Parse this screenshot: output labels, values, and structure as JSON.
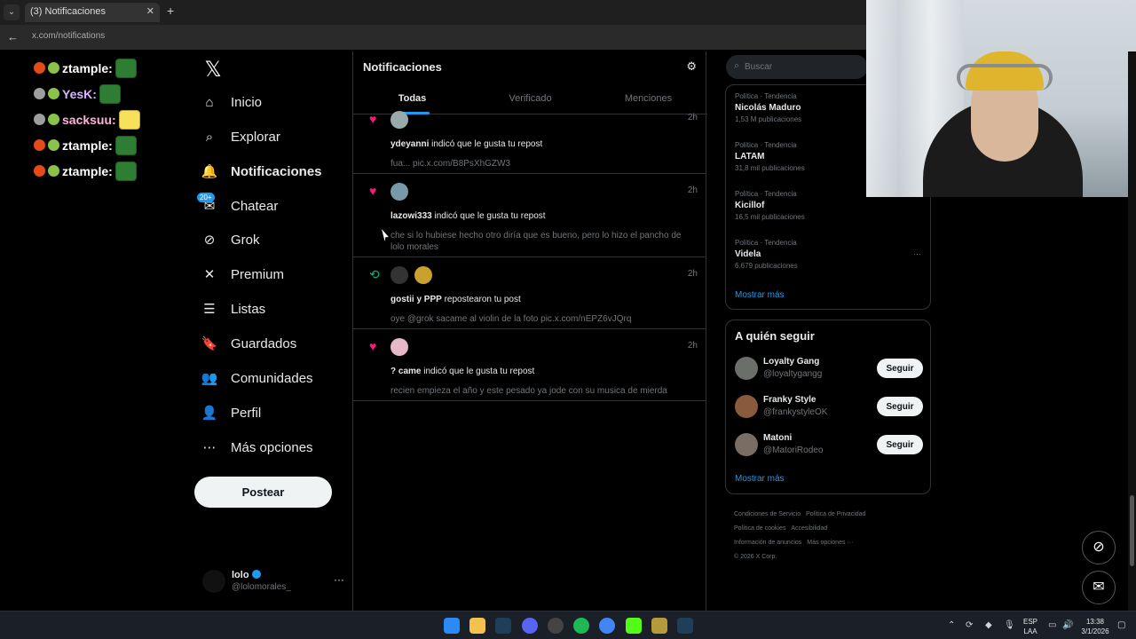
{
  "browser": {
    "tab_title": "(3) Notificaciones",
    "url": "x.com/notifications"
  },
  "chat_overlay": [
    {
      "user": "ztample:",
      "color": "#ffffff",
      "badge": "#e64a19",
      "emote": "green"
    },
    {
      "user": "YesK:",
      "color": "#d7b4ff",
      "badge": "#9e9e9e",
      "emote": "green"
    },
    {
      "user": "sacksuu:",
      "color": "#ffb3d9",
      "badge": "#9e9e9e",
      "emote": "sponge"
    },
    {
      "user": "ztample:",
      "color": "#ffffff",
      "badge": "#e64a19",
      "emote": "green"
    },
    {
      "user": "ztample:",
      "color": "#ffffff",
      "badge": "#e64a19",
      "emote": "green"
    }
  ],
  "nav": {
    "items": [
      {
        "label": "Inicio",
        "icon": "home-icon"
      },
      {
        "label": "Explorar",
        "icon": "search-icon"
      },
      {
        "label": "Notificaciones",
        "icon": "bell-icon"
      },
      {
        "label": "Chatear",
        "icon": "chat-icon"
      },
      {
        "label": "Grok",
        "icon": "grok-icon"
      },
      {
        "label": "Premium",
        "icon": "x-icon"
      },
      {
        "label": "Listas",
        "icon": "list-icon"
      },
      {
        "label": "Guardados",
        "icon": "bookmark-icon"
      },
      {
        "label": "Comunidades",
        "icon": "communities-icon"
      },
      {
        "label": "Perfil",
        "icon": "person-icon"
      },
      {
        "label": "Más opciones",
        "icon": "more-circle-icon"
      }
    ],
    "chat_badge": "20+",
    "post_label": "Postear",
    "account": {
      "name": "lolo",
      "handle": "@lolomorales_"
    }
  },
  "center": {
    "title": "Notificaciones",
    "tabs": [
      "Todas",
      "Verificado",
      "Menciones"
    ],
    "notifications": [
      {
        "kind": "like",
        "time": "2h",
        "actors": "ydeyanni",
        "action": " indicó que le gusta tu repost",
        "preview": "fua... pic.x.com/B8PsXhGZW3"
      },
      {
        "kind": "like",
        "time": "2h",
        "actors": "lazowi333",
        "action": " indicó que le gusta tu repost",
        "preview": "che si lo hubiese hecho otro diría que es bueno, pero lo hizo el pancho de lolo morales"
      },
      {
        "kind": "repost",
        "time": "2h",
        "actors": "gostii y PPP",
        "action": " repostearon tu post",
        "preview": "oye @grok sacame al violin de la foto pic.x.com/nEPZ6vJQrq"
      },
      {
        "kind": "like",
        "time": "2h",
        "actors": "? came",
        "action": " indicó que le gusta tu repost",
        "preview": "recien empieza el año y este pesado ya jode con su musica de mierda"
      }
    ]
  },
  "right": {
    "search_placeholder": "Buscar",
    "trends": [
      {
        "category": "Política · Tendencia",
        "title": "Nicolás Maduro",
        "count": "1,53 M publicaciones"
      },
      {
        "category": "Política · Tendencia",
        "title": "LATAM",
        "count": "31,8 mil publicaciones"
      },
      {
        "category": "Política · Tendencia",
        "title": "Kicillof",
        "count": "16,5 mil publicaciones"
      },
      {
        "category": "Política · Tendencia",
        "title": "Videla",
        "count": "6.679 publicaciones"
      }
    ],
    "show_more": "Mostrar más",
    "who_to_follow_title": "A quién seguir",
    "follow": [
      {
        "name": "Loyalty Gang",
        "handle": "@loyaltygangg",
        "button": "Seguir"
      },
      {
        "name": "Franky Style",
        "handle": "@frankystyleOK",
        "button": "Seguir"
      },
      {
        "name": "Matoni",
        "handle": "@MatoriRodeo",
        "button": "Seguir"
      }
    ],
    "footer": [
      "Condiciones de Servicio",
      "Política de Privacidad",
      "Política de cookies",
      "Accesibilidad",
      "Información de anuncios",
      "Más opciones ···",
      "© 2026 X Corp."
    ]
  },
  "taskbar": {
    "lang": "ESP",
    "lang2": "LAA",
    "time": "13:38",
    "date": "3/1/2026"
  }
}
